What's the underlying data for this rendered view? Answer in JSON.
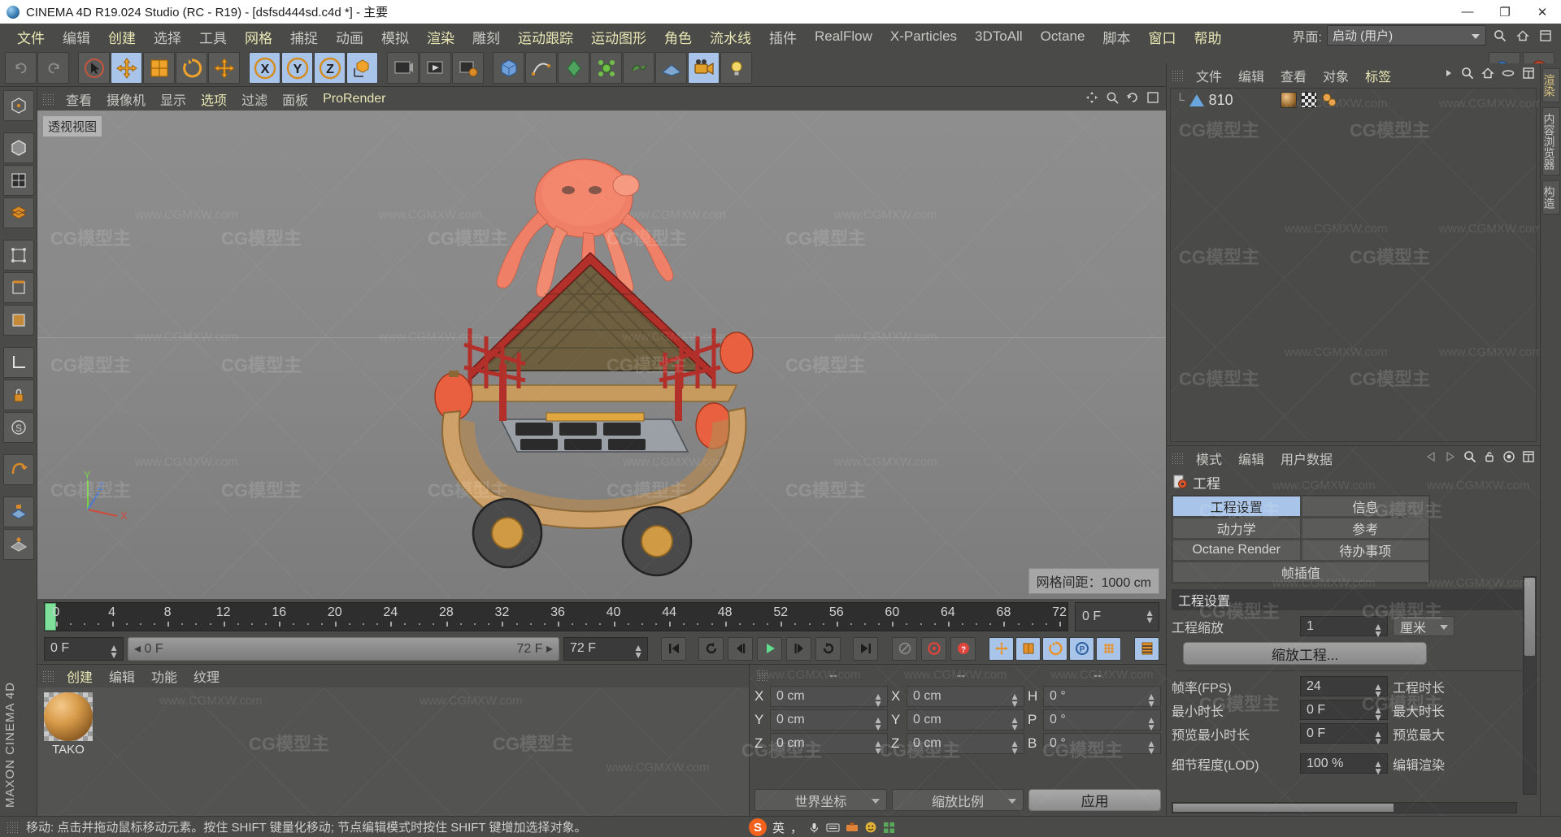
{
  "window": {
    "title": "CINEMA 4D R19.024 Studio (RC - R19) - [dsfsd444sd.c4d *] - 主要",
    "minimize": "—",
    "maximize": "❐",
    "close": "✕"
  },
  "menubar": {
    "items": [
      {
        "label": "文件",
        "highlight": true
      },
      {
        "label": "编辑",
        "highlight": false
      },
      {
        "label": "创建",
        "highlight": true
      },
      {
        "label": "选择",
        "highlight": false
      },
      {
        "label": "工具",
        "highlight": false
      },
      {
        "label": "网格",
        "highlight": true
      },
      {
        "label": "捕捉",
        "highlight": false
      },
      {
        "label": "动画",
        "highlight": false
      },
      {
        "label": "模拟",
        "highlight": false
      },
      {
        "label": "渲染",
        "highlight": true
      },
      {
        "label": "雕刻",
        "highlight": false
      },
      {
        "label": "运动跟踪",
        "highlight": true
      },
      {
        "label": "运动图形",
        "highlight": true
      },
      {
        "label": "角色",
        "highlight": true
      },
      {
        "label": "流水线",
        "highlight": true
      },
      {
        "label": "插件",
        "highlight": false
      },
      {
        "label": "RealFlow",
        "highlight": false
      },
      {
        "label": "X-Particles",
        "highlight": false
      },
      {
        "label": "3DToAll",
        "highlight": false
      },
      {
        "label": "Octane",
        "highlight": false
      },
      {
        "label": "脚本",
        "highlight": false
      },
      {
        "label": "窗口",
        "highlight": true
      },
      {
        "label": "帮助",
        "highlight": true
      }
    ],
    "interface_label": "界面:",
    "interface_value": "启动 (用户)"
  },
  "viewport": {
    "menu": [
      {
        "label": "查看",
        "highlight": false
      },
      {
        "label": "摄像机",
        "highlight": false
      },
      {
        "label": "显示",
        "highlight": false
      },
      {
        "label": "选项",
        "highlight": true
      },
      {
        "label": "过滤",
        "highlight": false
      },
      {
        "label": "面板",
        "highlight": false
      },
      {
        "label": "ProRender",
        "highlight": true
      }
    ],
    "label": "透视视图",
    "grid_info": "网格间距：1000 cm",
    "axis": {
      "x": "X",
      "y": "Y",
      "z": "Z"
    }
  },
  "timeline": {
    "ticks": [
      0,
      4,
      8,
      12,
      16,
      20,
      24,
      28,
      32,
      36,
      40,
      44,
      48,
      52,
      56,
      60,
      64,
      68,
      72
    ],
    "current_frame": "0 F",
    "current_frame_2": "0 F",
    "range_start": "0 F",
    "range_end": "72 F",
    "range_total": "72 F",
    "playhead_frame": 0
  },
  "material_manager": {
    "menu": [
      {
        "label": "创建",
        "highlight": true
      },
      {
        "label": "编辑",
        "highlight": false
      },
      {
        "label": "功能",
        "highlight": false
      },
      {
        "label": "纹理",
        "highlight": false
      }
    ],
    "materials": [
      {
        "name": "TAKO"
      }
    ]
  },
  "coordinates": {
    "headers": [
      "--",
      "--",
      "--"
    ],
    "position": {
      "label_x": "X",
      "label_y": "Y",
      "label_z": "Z",
      "x": "0 cm",
      "y": "0 cm",
      "z": "0 cm"
    },
    "size": {
      "label_x": "X",
      "label_y": "Y",
      "label_z": "Z",
      "x": "0 cm",
      "y": "0 cm",
      "z": "0 cm"
    },
    "rotation": {
      "label_h": "H",
      "label_p": "P",
      "label_b": "B",
      "h": "0 °",
      "p": "0 °",
      "b": "0 °"
    },
    "coord_system": "世界坐标",
    "size_mode": "缩放比例",
    "apply": "应用"
  },
  "object_manager": {
    "menu": [
      {
        "label": "文件",
        "highlight": false
      },
      {
        "label": "编辑",
        "highlight": false
      },
      {
        "label": "查看",
        "highlight": false
      },
      {
        "label": "对象",
        "highlight": false
      },
      {
        "label": "标签",
        "highlight": true
      }
    ],
    "rows": [
      {
        "name": "810"
      }
    ]
  },
  "attribute_manager": {
    "menu": [
      {
        "label": "模式",
        "highlight": false
      },
      {
        "label": "编辑",
        "highlight": false
      },
      {
        "label": "用户数据",
        "highlight": false
      }
    ],
    "title": "工程",
    "tabs": [
      {
        "label": "工程设置",
        "active": true
      },
      {
        "label": "信息",
        "active": false
      },
      {
        "label": "动力学",
        "active": false
      },
      {
        "label": "参考",
        "active": false
      },
      {
        "label": "Octane Render",
        "active": false
      },
      {
        "label": "待办事项",
        "active": false
      },
      {
        "label": "帧插值",
        "active": false
      }
    ],
    "section_title": "工程设置",
    "rows": [
      {
        "label": "工程缩放",
        "value": "1",
        "unit": "厘米",
        "right": ""
      },
      {
        "label": "帧率(FPS)",
        "value": "24",
        "right": "工程时长"
      },
      {
        "label": "最小时长",
        "value": "0 F",
        "right": "最大时长"
      },
      {
        "label": "预览最小时长",
        "value": "0 F",
        "right": "预览最大"
      },
      {
        "label": "细节程度(LOD)",
        "value": "100 %",
        "right": "编辑渲染"
      }
    ],
    "scale_button": "缩放工程..."
  },
  "right_rail": {
    "tabs": [
      "渲染",
      "内容浏览器",
      "构造"
    ]
  },
  "statusbar": {
    "text": "移动: 点击并拖动鼠标移动元素。按住 SHIFT 键量化移动; 节点编辑模式时按住 SHIFT 键增加选择对象。",
    "ime_logo": "S",
    "ime_mode": "英"
  },
  "branding": {
    "maxon": "MAXON CINEMA 4D"
  },
  "colors": {
    "accent_selected": "#a8c4e8",
    "menu_highlight": "#e8e7b4",
    "panel_bg": "#4a4a48",
    "field_bg": "#3b3b3b",
    "playhead": "#7ee09a",
    "axis_x": "#d04a3a",
    "axis_y": "#7ad04a",
    "axis_z": "#4a7ad0"
  }
}
